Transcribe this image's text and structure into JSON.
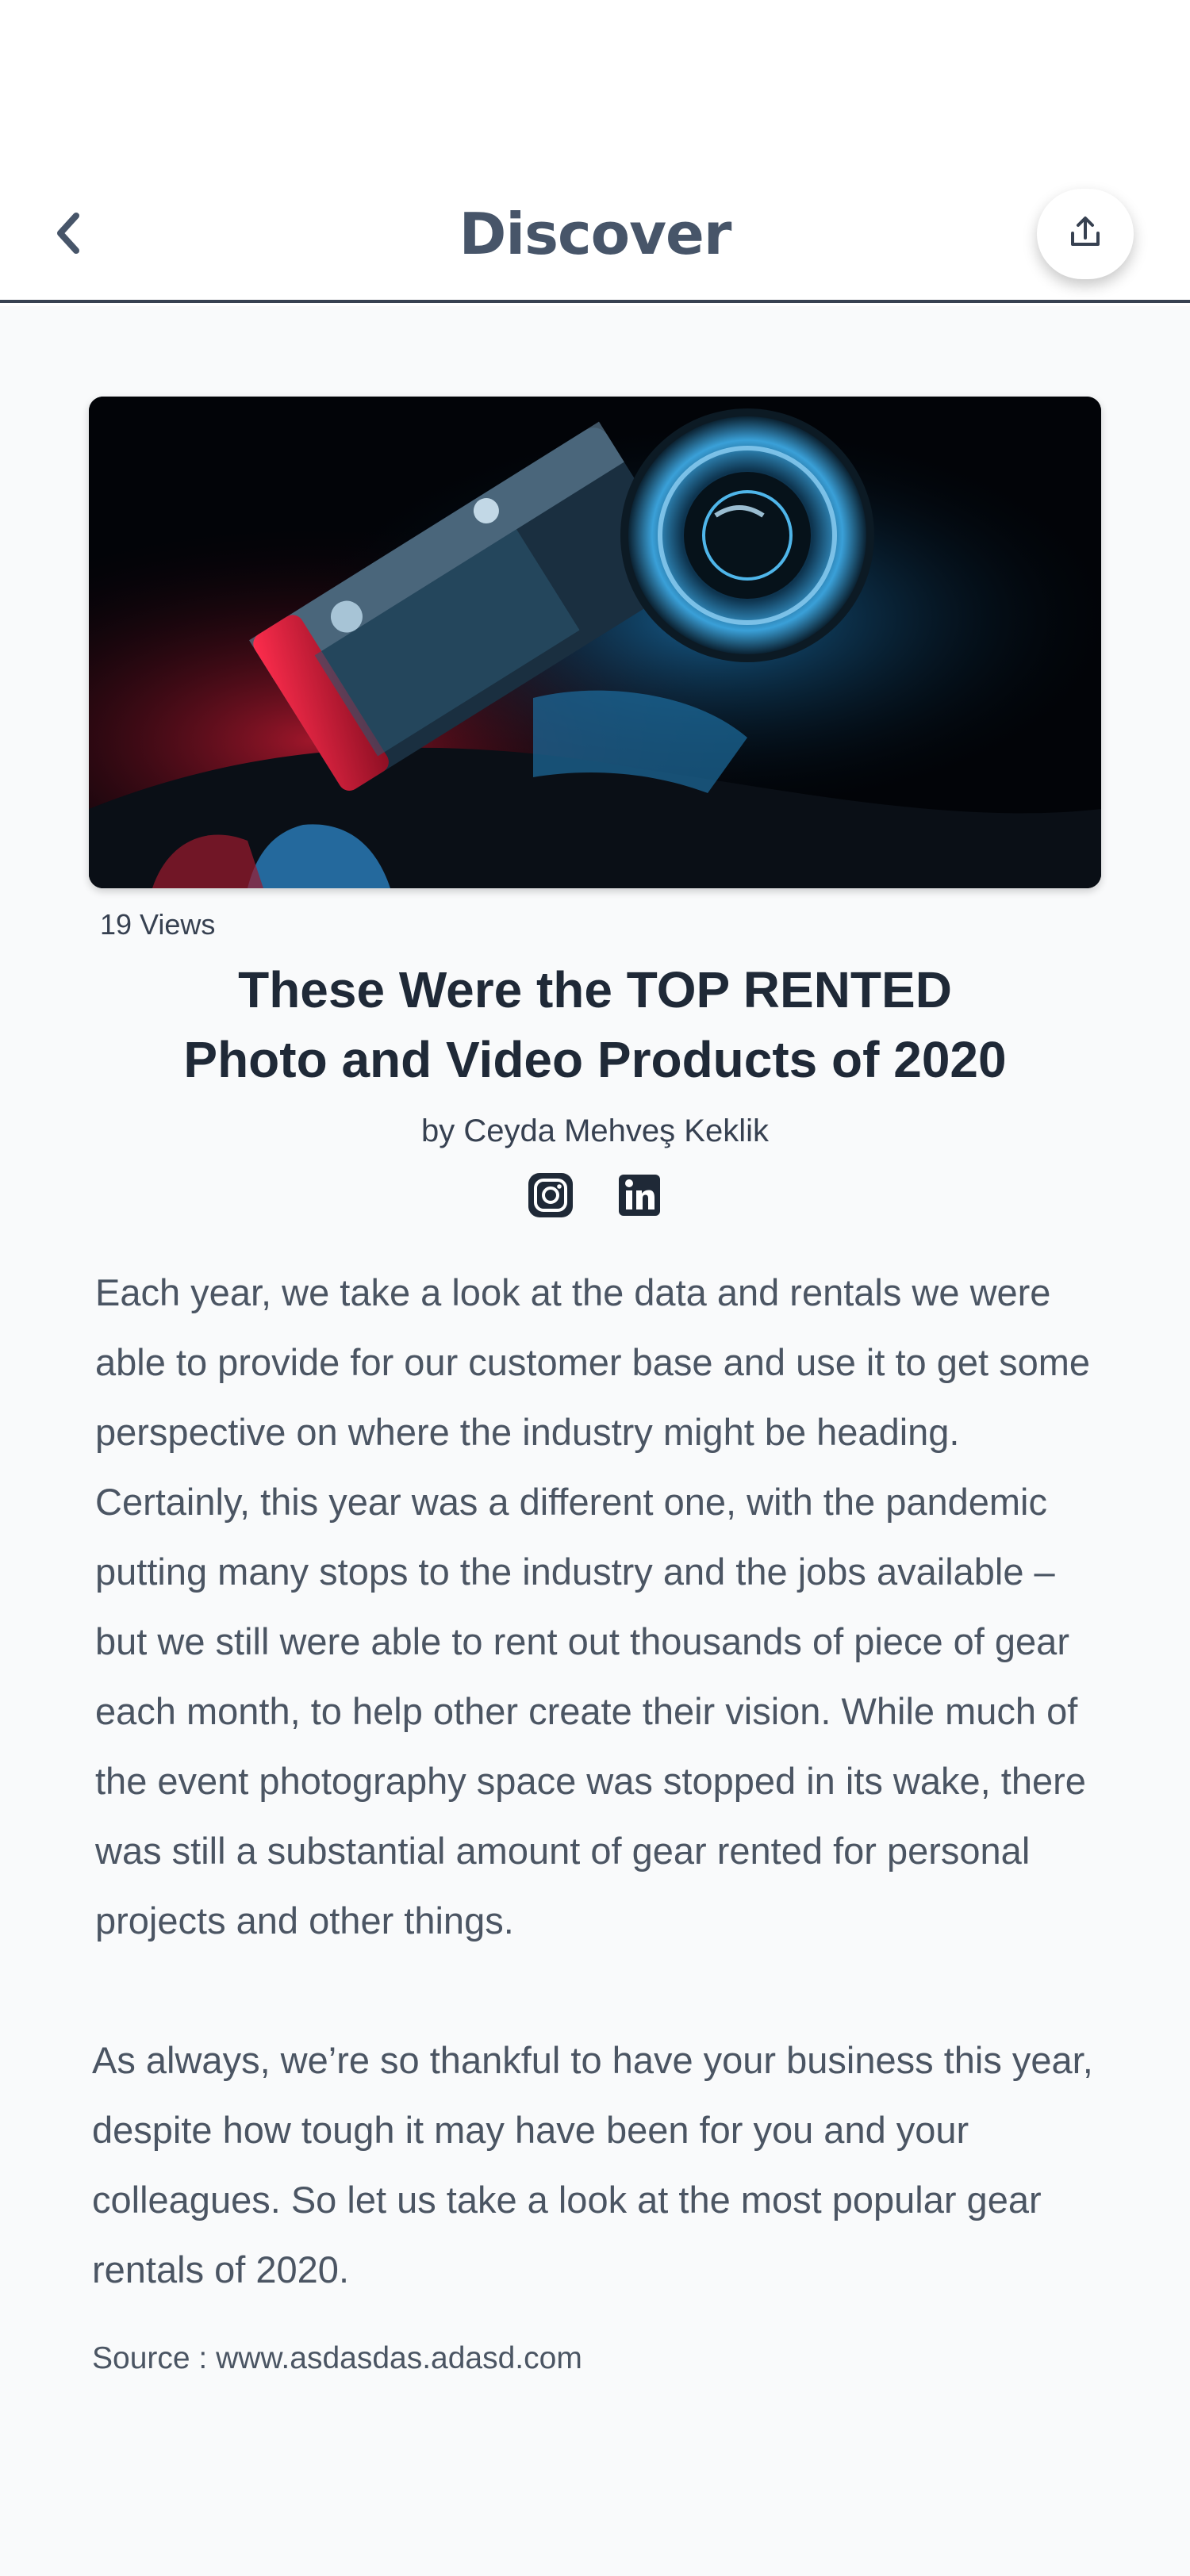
{
  "header": {
    "title": "Discover",
    "back_icon": "chevron-left-icon",
    "share_icon": "share-upload-icon"
  },
  "article": {
    "hero_image": "camera-photo",
    "views": "19 Views",
    "title_line1": "These Were the TOP RENTED",
    "title_line2": "Photo and Video Products of 2020",
    "author": "by Ceyda Mehveş Keklik",
    "socials": [
      {
        "icon": "instagram-icon"
      },
      {
        "icon": "linkedin-icon"
      }
    ],
    "paragraph1": "Each year, we take a look at the data and rentals we were able to provide for our customer base and use it to get some perspective on where the industry might be heading. Certainly, this year was a different one, with the pandemic putting many stops to the industry and the jobs available – but we still were able to rent out thousands of piece of gear each month, to help other create their vision. While much of the event photography space was stopped in its wake, there was still a substantial amount of gear rented for personal projects and other things.",
    "paragraph2": "As always, we’re so thankful to have your business this year, despite how tough it may have been for you and your colleagues. So let us take a look at the most popular gear rentals of 2020.",
    "source": "Source : www.asdasdas.adasd.com"
  },
  "colors": {
    "header_divider": "#374151",
    "title_text": "#475569",
    "body_text": "#4b5563",
    "background": "#f9fafb"
  }
}
